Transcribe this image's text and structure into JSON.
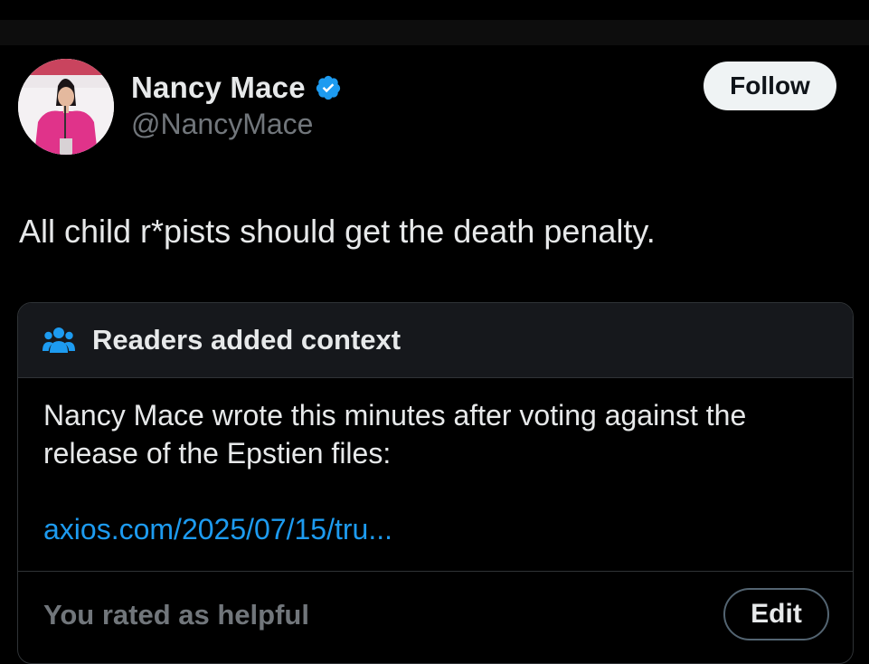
{
  "author": {
    "display_name": "Nancy Mace",
    "handle": "@NancyMace",
    "verified": true,
    "verified_color": "#1d9bf0"
  },
  "follow_button": {
    "label": "Follow"
  },
  "tweet": {
    "text": "All child r*pists should get the death penalty."
  },
  "community_note": {
    "title": "Readers added context",
    "icon": "people-icon",
    "body": "Nancy Mace wrote this minutes after voting against the release of the Epstien files:",
    "link": "axios.com/2025/07/15/tru...",
    "link_color": "#1d9bf0",
    "rating_status": "You rated as helpful",
    "edit_label": "Edit"
  },
  "colors": {
    "background": "#000000",
    "text_primary": "#e7e9ea",
    "text_secondary": "#71767b",
    "note_header_bg": "#16181c",
    "border": "#2f3336"
  }
}
